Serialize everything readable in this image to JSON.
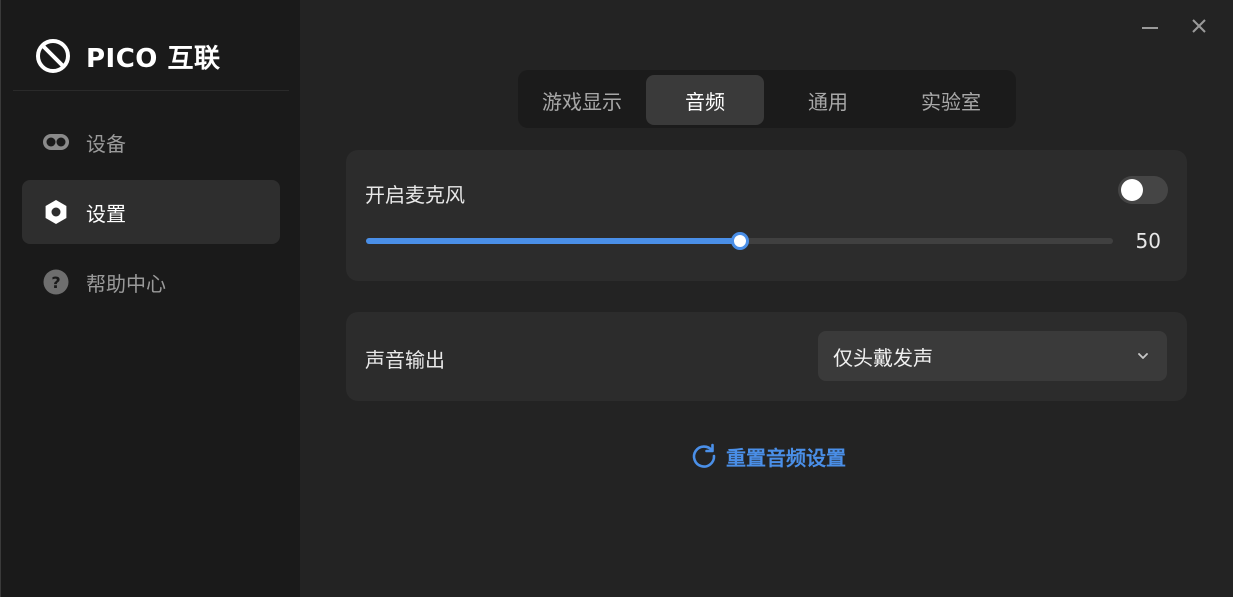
{
  "app": {
    "brand": "PICO 互联"
  },
  "sidebar": {
    "items": [
      {
        "label": "设备",
        "icon": "vr-headset-icon",
        "active": false
      },
      {
        "label": "设置",
        "icon": "settings-icon",
        "active": true
      },
      {
        "label": "帮助中心",
        "icon": "help-icon",
        "active": false
      }
    ]
  },
  "window_controls": {
    "minimize_icon": "minimize-icon",
    "close_icon": "close-icon"
  },
  "tabs": [
    {
      "label": "游戏显示",
      "active": false
    },
    {
      "label": "音频",
      "active": true
    },
    {
      "label": "通用",
      "active": false
    },
    {
      "label": "实验室",
      "active": false
    }
  ],
  "microphone": {
    "label": "开启麦克风",
    "enabled": false,
    "volume": 50,
    "volume_max": 100
  },
  "output": {
    "label": "声音输出",
    "selected": "仅头戴发声"
  },
  "reset": {
    "label": "重置音频设置",
    "icon": "refresh-icon"
  },
  "colors": {
    "accent": "#4a8fe8",
    "sidebar_bg": "#1a1a1a",
    "main_bg": "#232323",
    "card_bg": "#2c2c2c"
  }
}
